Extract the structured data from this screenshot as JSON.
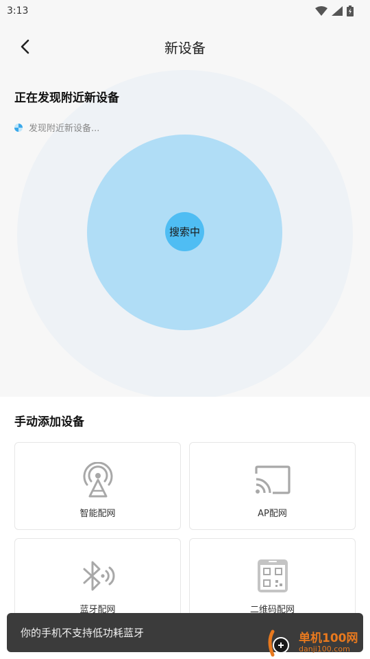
{
  "status_bar": {
    "time": "3:13"
  },
  "nav": {
    "title": "新设备"
  },
  "discover": {
    "title": "正在发现附近新设备",
    "status_text": "发现附近新设备...",
    "center_label": "搜索中"
  },
  "manual": {
    "title": "手动添加设备",
    "cards": [
      {
        "label": "智能配网",
        "icon": "antenna-icon"
      },
      {
        "label": "AP配网",
        "icon": "cast-icon"
      },
      {
        "label": "蓝牙配网",
        "icon": "bluetooth-icon"
      },
      {
        "label": "二维码配网",
        "icon": "qr-code-icon"
      }
    ]
  },
  "toast": {
    "message": "你的手机不支持低功耗蓝牙"
  },
  "watermark": {
    "title": "单机100网",
    "url": "danji100.com"
  },
  "colors": {
    "accent": "#4fbdf3",
    "radar_inner": "#b0ddf6",
    "radar_outer": "#eef2f6",
    "toast_bg": "#3b3b3b",
    "watermark": "#e8791e"
  }
}
